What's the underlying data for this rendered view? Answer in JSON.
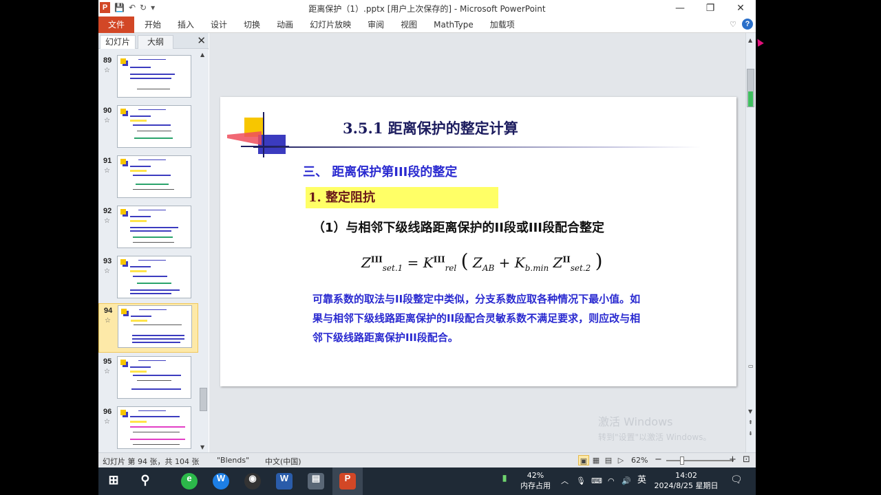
{
  "window": {
    "title": "距离保护（1）.pptx [用户上次保存的] - Microsoft PowerPoint",
    "minimize": "—",
    "restore": "❐",
    "close": "✕"
  },
  "qat": {
    "save_icon": "💾",
    "undo_icon": "↶",
    "redo_icon": "↻",
    "customize_icon": "▾"
  },
  "ribbon": {
    "file_tab": "文件",
    "tabs": [
      "开始",
      "插入",
      "设计",
      "切换",
      "动画",
      "幻灯片放映",
      "审阅",
      "视图",
      "MathType",
      "加载项"
    ],
    "collapse_icon": "♡",
    "help_icon": "?"
  },
  "panel": {
    "tabs": [
      "幻灯片",
      "大纲"
    ],
    "close": "✕",
    "thumbnails": [
      {
        "number": "89",
        "star": "☆"
      },
      {
        "number": "90",
        "star": "☆"
      },
      {
        "number": "91",
        "star": "☆"
      },
      {
        "number": "92",
        "star": "☆"
      },
      {
        "number": "93",
        "star": "☆"
      },
      {
        "number": "94",
        "star": "☆"
      },
      {
        "number": "95",
        "star": "☆"
      },
      {
        "number": "96",
        "star": "☆"
      }
    ],
    "selected": "94"
  },
  "slide": {
    "title": "3.5.1 距离保护的整定计算",
    "section": "三、 距离保护第III段的整定",
    "subheading": "1. 整定阻抗",
    "body": "（1）与相邻下级线路距离保护的II段或III段配合整定",
    "formula": {
      "lhs": "Z",
      "lhs_sup": "III",
      "lhs_sub": "set.1",
      "eq": "=",
      "k": "K",
      "k_sup": "III",
      "k_sub": "rel",
      "open": "(",
      "zab": "Z",
      "zab_sub": "AB",
      "plus": "+",
      "kb": "K",
      "kb_sub": "b.min",
      "z2": "Z",
      "z2_sup": "II",
      "z2_sub": "set.2",
      "close": ")"
    },
    "note": "可靠系数的取法与II段整定中类似，分支系数应取各种情况下最小值。如果与相邻下级线路距离保护的II段配合灵敏系数不满足要求，则应改与相邻下级线路距离保护III段配合。"
  },
  "watermark": {
    "line1": "激活 Windows",
    "line2": "转到\"设置\"以激活 Windows。"
  },
  "statusbar": {
    "slide_info": "幻灯片 第 94 张，共 104 张",
    "theme": "\"Blends\"",
    "language": "中文(中国)",
    "zoom": "62%",
    "zoom_minus": "−",
    "zoom_plus": "+"
  },
  "taskbar": {
    "battery_percent": "42%",
    "memory_label": "内存占用",
    "ime": "英",
    "time": "14:02",
    "date": "2024/8/25 星期日"
  }
}
